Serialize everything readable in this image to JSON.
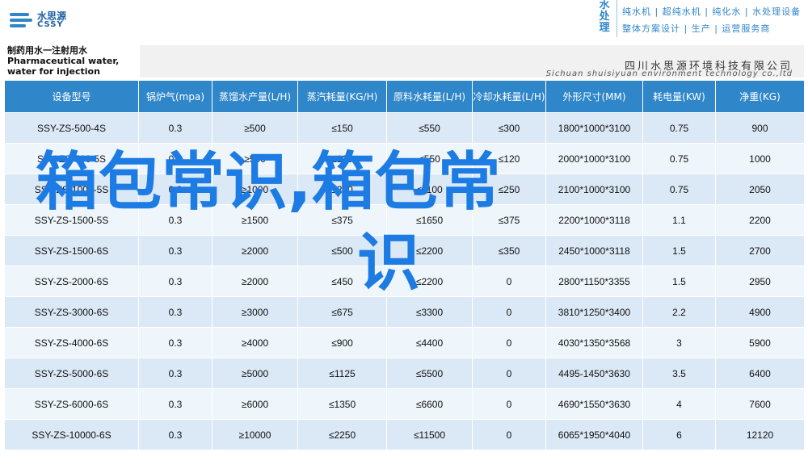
{
  "logo": {
    "name_cn": "水思源",
    "name_en": "CSSY"
  },
  "brand": {
    "vertical": "水处理",
    "lines": [
      "纯水机 | 超纯水机 | 纯化水 | 水处理设备",
      "整体方案设计 | 生产 | 运营服务商"
    ]
  },
  "doc": {
    "title_cn": "制药用水一注射用水",
    "title_en": "Pharmaceutical water, water for injection",
    "company_cn": "四川水思源环境科技有限公司",
    "company_en": "Sichuan shuisiyuan environment technology co.,ltd"
  },
  "table": {
    "headers": [
      "设备型号",
      "锅炉气(mpa)",
      "蒸馏水产量(L/H)",
      "蒸汽耗量(KG/H)",
      "原料水耗量(L/H)",
      "冷却水耗量(L/H)",
      "外形尺寸(MM)",
      "耗电量(KW)",
      "净重(KG)"
    ],
    "rows": [
      [
        "SSY-ZS-500-4S",
        "0.3",
        "≥500",
        "≤150",
        "≤550",
        "≤300",
        "1800*1000*3100",
        "0.75",
        "900"
      ],
      [
        "SSY-ZS-500-5S",
        "0.3",
        "≥500",
        "≤125",
        "≤550",
        "≤120",
        "2000*1000*3100",
        "0.75",
        "1000"
      ],
      [
        "SSY-ZS-1000-5S",
        "0.3",
        "≥1000",
        "≤250",
        "≤1100",
        "≤250",
        "2100*1000*3100",
        "0.75",
        "2050"
      ],
      [
        "SSY-ZS-1500-5S",
        "0.3",
        "≥1500",
        "≤375",
        "≤1650",
        "≤375",
        "2200*1000*3118",
        "1.1",
        "2200"
      ],
      [
        "SSY-ZS-1500-6S",
        "0.3",
        "≥2000",
        "≤500",
        "≤2200",
        "≤350",
        "2450*1000*3118",
        "1.5",
        "2700"
      ],
      [
        "SSY-ZS-2000-6S",
        "0.3",
        "≥2000",
        "≤450",
        "≤2200",
        "0",
        "2800*1150*3355",
        "1.5",
        "2950"
      ],
      [
        "SSY-ZS-3000-6S",
        "0.3",
        "≥3000",
        "≤675",
        "≤3300",
        "0",
        "3810*1250*3400",
        "2.2",
        "4900"
      ],
      [
        "SSY-ZS-4000-6S",
        "0.3",
        "≥4000",
        "≤900",
        "≤4400",
        "0",
        "4030*1350*3568",
        "3",
        "5900"
      ],
      [
        "SSY-ZS-5000-6S",
        "0.3",
        "≥5000",
        "≤1125",
        "≤5500",
        "0",
        "4495-1450*3630",
        "3.5",
        "6400"
      ],
      [
        "SSY-ZS-6000-6S",
        "0.3",
        "≥6000",
        "≤1350",
        "≤6600",
        "0",
        "4690*1550*3630",
        "4",
        "7600"
      ],
      [
        "SSY-ZS-10000-6S",
        "0.3",
        "≥10000",
        "≤2250",
        "≤11500",
        "0",
        "6065*1950*4040",
        "6",
        "12120"
      ]
    ]
  },
  "watermark": {
    "line1": "箱包常识,箱包常",
    "line2": "识"
  },
  "colors": {
    "header_blue": "#2f86c9",
    "row_light": "#dbe9f6",
    "row_lighter": "#eef5fb",
    "watermark": "#1d7be4"
  }
}
